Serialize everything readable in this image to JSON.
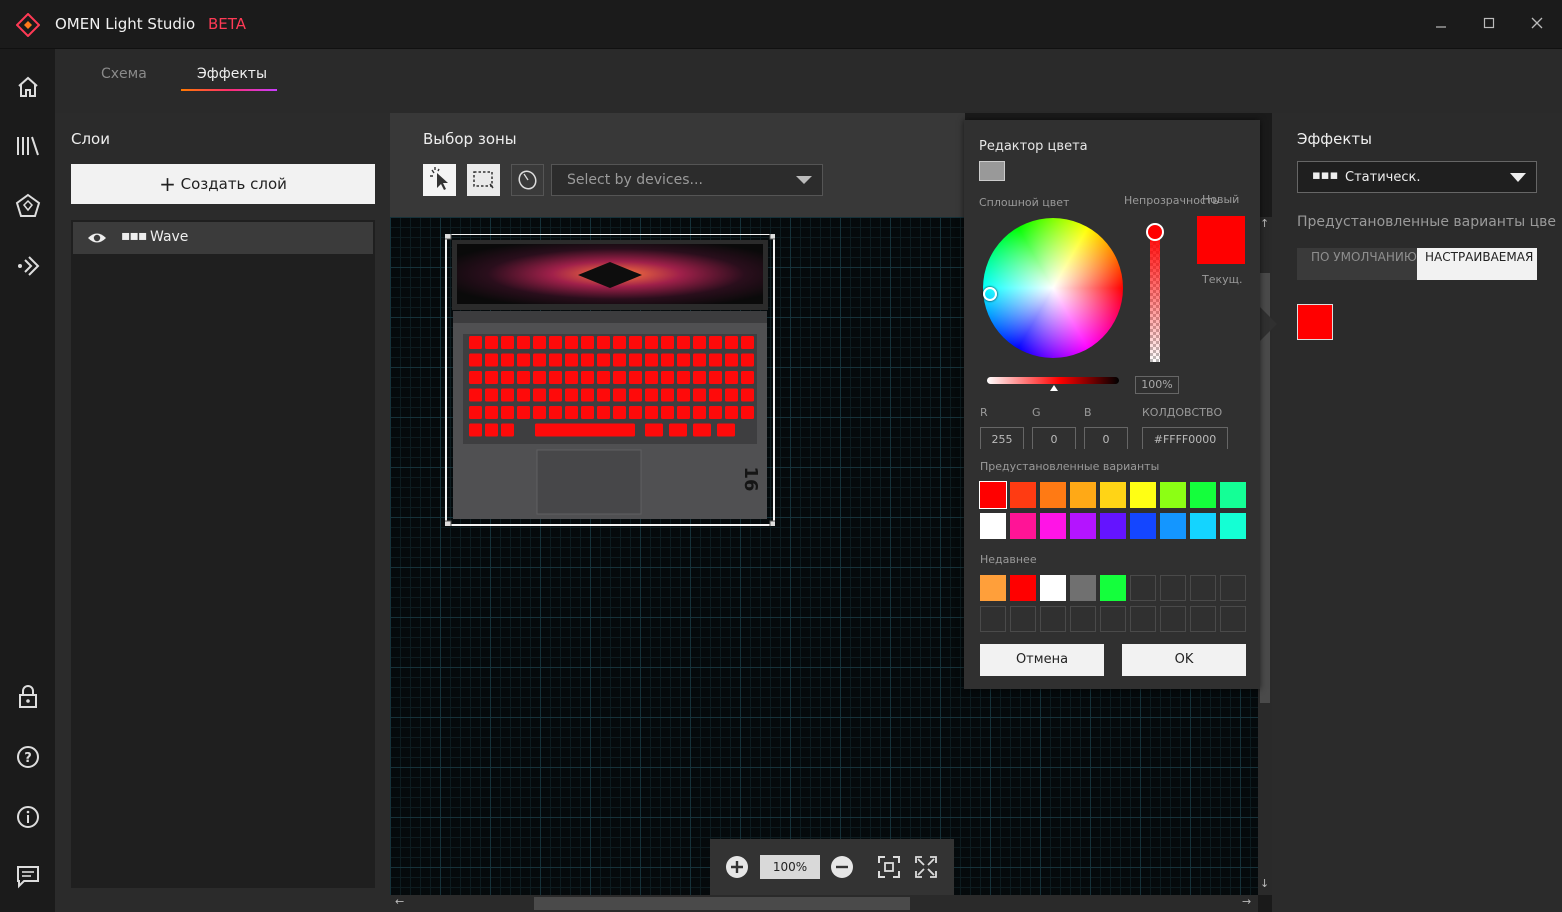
{
  "app": {
    "title": "OMEN Light Studio",
    "beta": "BETA",
    "accent": "#ff3a55"
  },
  "window": {
    "minimize_icon": "minimize-icon",
    "maximize_icon": "maximize-icon",
    "close_icon": "close-icon"
  },
  "nav": [
    "home-icon",
    "library-icon",
    "pentagon-icon",
    "broadcast-icon",
    "lock-icon",
    "help-icon",
    "info-icon",
    "feedback-icon"
  ],
  "tabs": {
    "scheme": "Схема",
    "effects": "Эффекты",
    "active": "effects"
  },
  "layers": {
    "title": "Слои",
    "create_label": "Создать слой",
    "items": [
      {
        "name": "Wave",
        "dots": "▪▪▪"
      }
    ]
  },
  "zone": {
    "title": "Выбор зоны",
    "device_placeholder": "Select by devices...",
    "zoom": "100%"
  },
  "color_editor": {
    "title": "Редактор цвета",
    "solid_label": "Сплошной цвет",
    "opacity_label": "Непрозрачность",
    "new_label": "Новый",
    "current_label": "Текущ.",
    "opacity_value": "100%",
    "r_label": "R",
    "g_label": "G",
    "b_label": "B",
    "hex_label": "КОЛДОВСТВО",
    "r": "255",
    "g": "0",
    "b": "0",
    "hex": "#FFFF0000",
    "presets_label": "Предустановленные варианты",
    "preset_colors": [
      "#ff0000",
      "#ff3b12",
      "#ff7a14",
      "#ffa916",
      "#ffd416",
      "#ffff14",
      "#8cff14",
      "#14ff3c",
      "#14ff96",
      "#ffffff",
      "#ff1496",
      "#ff14e6",
      "#b414ff",
      "#6414ff",
      "#1446ff",
      "#1496ff",
      "#14d4ff",
      "#14ffd4"
    ],
    "recent_label": "Недавнее",
    "recent_colors": [
      "#ff9f3a",
      "#ff0000",
      "#ffffff",
      "#707070",
      "#14ff3c"
    ],
    "cancel": "Отмена",
    "ok": "OK",
    "new_color": "#ff0000"
  },
  "effects": {
    "title": "Эффекты",
    "selected": "Статическ.",
    "dots": "▪▪▪",
    "presets_label": "Предустановленные варианты цве",
    "default_label": "ПО УМОЛЧАНИЮ",
    "custom_label": "НАСТРАИВАЕМАЯ",
    "color": "#ff0000"
  }
}
